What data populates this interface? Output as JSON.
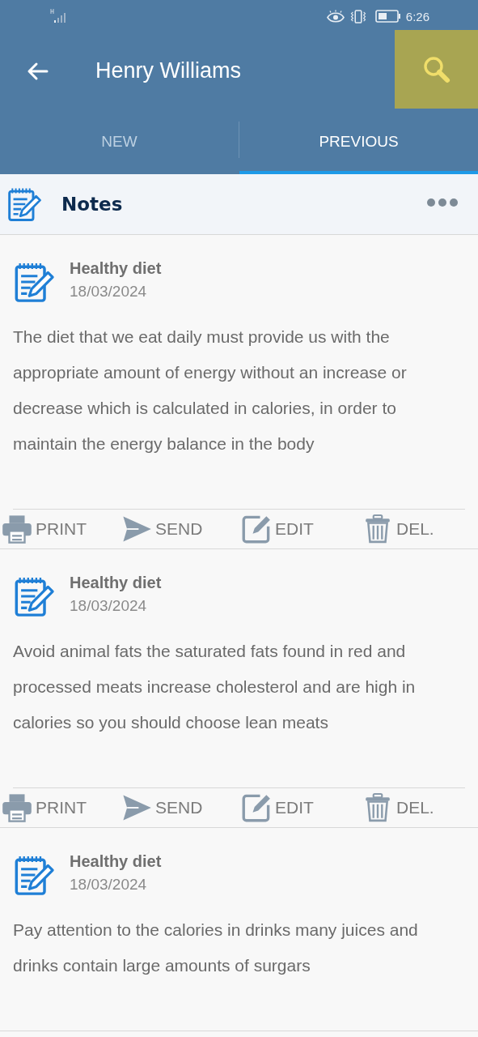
{
  "status_bar": {
    "time": "6:26"
  },
  "app_bar": {
    "title": "Henry Williams",
    "search_highlighted": true
  },
  "tabs": [
    {
      "label": "NEW",
      "selected": false
    },
    {
      "label": "PREVIOUS",
      "selected": true
    }
  ],
  "section": {
    "title": "Notes"
  },
  "notes": [
    {
      "title": "Healthy diet",
      "date": "18/03/2024",
      "body": "The diet that we eat daily must provide us with the appropriate amount of energy without an increase or decrease which is calculated in calories, in order to maintain the energy balance in the body",
      "actions": [
        {
          "kind": "print",
          "label": "PRINT"
        },
        {
          "kind": "send",
          "label": "SEND"
        },
        {
          "kind": "edit",
          "label": "EDIT"
        },
        {
          "kind": "delete",
          "label": "DEL."
        }
      ]
    },
    {
      "title": "Healthy diet",
      "date": "18/03/2024",
      "body": "Avoid animal fats the saturated fats found in red and processed meats increase cholesterol and are high in calories so you should choose lean meats",
      "actions": [
        {
          "kind": "print",
          "label": "PRINT"
        },
        {
          "kind": "send",
          "label": "SEND"
        },
        {
          "kind": "edit",
          "label": "EDIT"
        },
        {
          "kind": "delete",
          "label": "DEL."
        }
      ]
    },
    {
      "title": "Healthy diet",
      "date": "18/03/2024",
      "body": "Pay attention to the calories in drinks many juices and drinks contain large amounts of surgars"
    }
  ]
}
